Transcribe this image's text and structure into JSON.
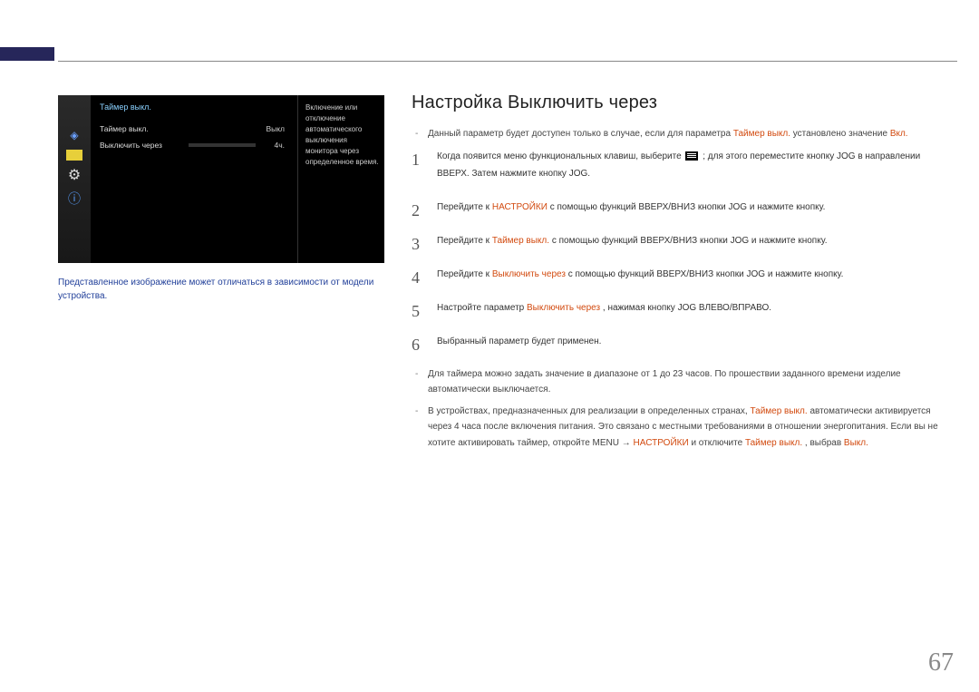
{
  "page_number": "67",
  "osd": {
    "title": "Таймер выкл.",
    "rows": [
      {
        "label": "Таймер выкл.",
        "value": "Выкл"
      },
      {
        "label": "Выключить через",
        "value": "4ч."
      }
    ],
    "description": "Включение или отключение автоматического выключения монитора через определенное время."
  },
  "caption": "Представленное изображение может отличаться в зависимости от модели устройства.",
  "title": "Настройка Выключить через",
  "intro_note_a": "Данный параметр будет доступен только в случае, если для параметра ",
  "intro_note_hl1": "Таймер выкл.",
  "intro_note_b": " установлено значение ",
  "intro_note_hl2": "Вкл.",
  "steps": {
    "s1a": "Когда появится меню функциональных клавиш, выберите ",
    "s1b": " ; для этого переместите кнопку JOG в направлении ВВЕРХ. Затем нажмите кнопку JOG.",
    "s2a": "Перейдите к ",
    "s2hl": "НАСТРОЙКИ",
    "s2b": " с помощью функций ВВЕРХ/ВНИЗ кнопки JOG и нажмите кнопку.",
    "s3a": "Перейдите к ",
    "s3hl": "Таймер выкл.",
    "s3b": " с помощью функций ВВЕРХ/ВНИЗ кнопки JOG и нажмите кнопку.",
    "s4a": "Перейдите к ",
    "s4hl": "Выключить через",
    "s4b": " с помощью функций ВВЕРХ/ВНИЗ кнопки JOG и нажмите кнопку.",
    "s5a": "Настройте параметр ",
    "s5hl": "Выключить через",
    "s5b": ", нажимая кнопку JOG ВЛЕВО/ВПРАВО.",
    "s6": "Выбранный параметр будет применен."
  },
  "footnotes": {
    "f1": "Для таймера можно задать значение в диапазоне от 1 до 23 часов. По прошествии заданного времени изделие автоматически выключается.",
    "f2a": "В устройствах, предназначенных для реализации в определенных странах, ",
    "f2hl1": "Таймер выкл.",
    "f2b": " автоматически активируется через 4 часа после включения питания. Это связано с местными требованиями в отношении энергопитания. Если вы не хотите активировать таймер, откройте MENU → ",
    "f2hl2": "НАСТРОЙКИ",
    "f2c": " и отключите ",
    "f2hl3": "Таймер выкл.",
    "f2d": ", выбрав ",
    "f2hl4": "Выкл.",
    "f2e": ""
  }
}
